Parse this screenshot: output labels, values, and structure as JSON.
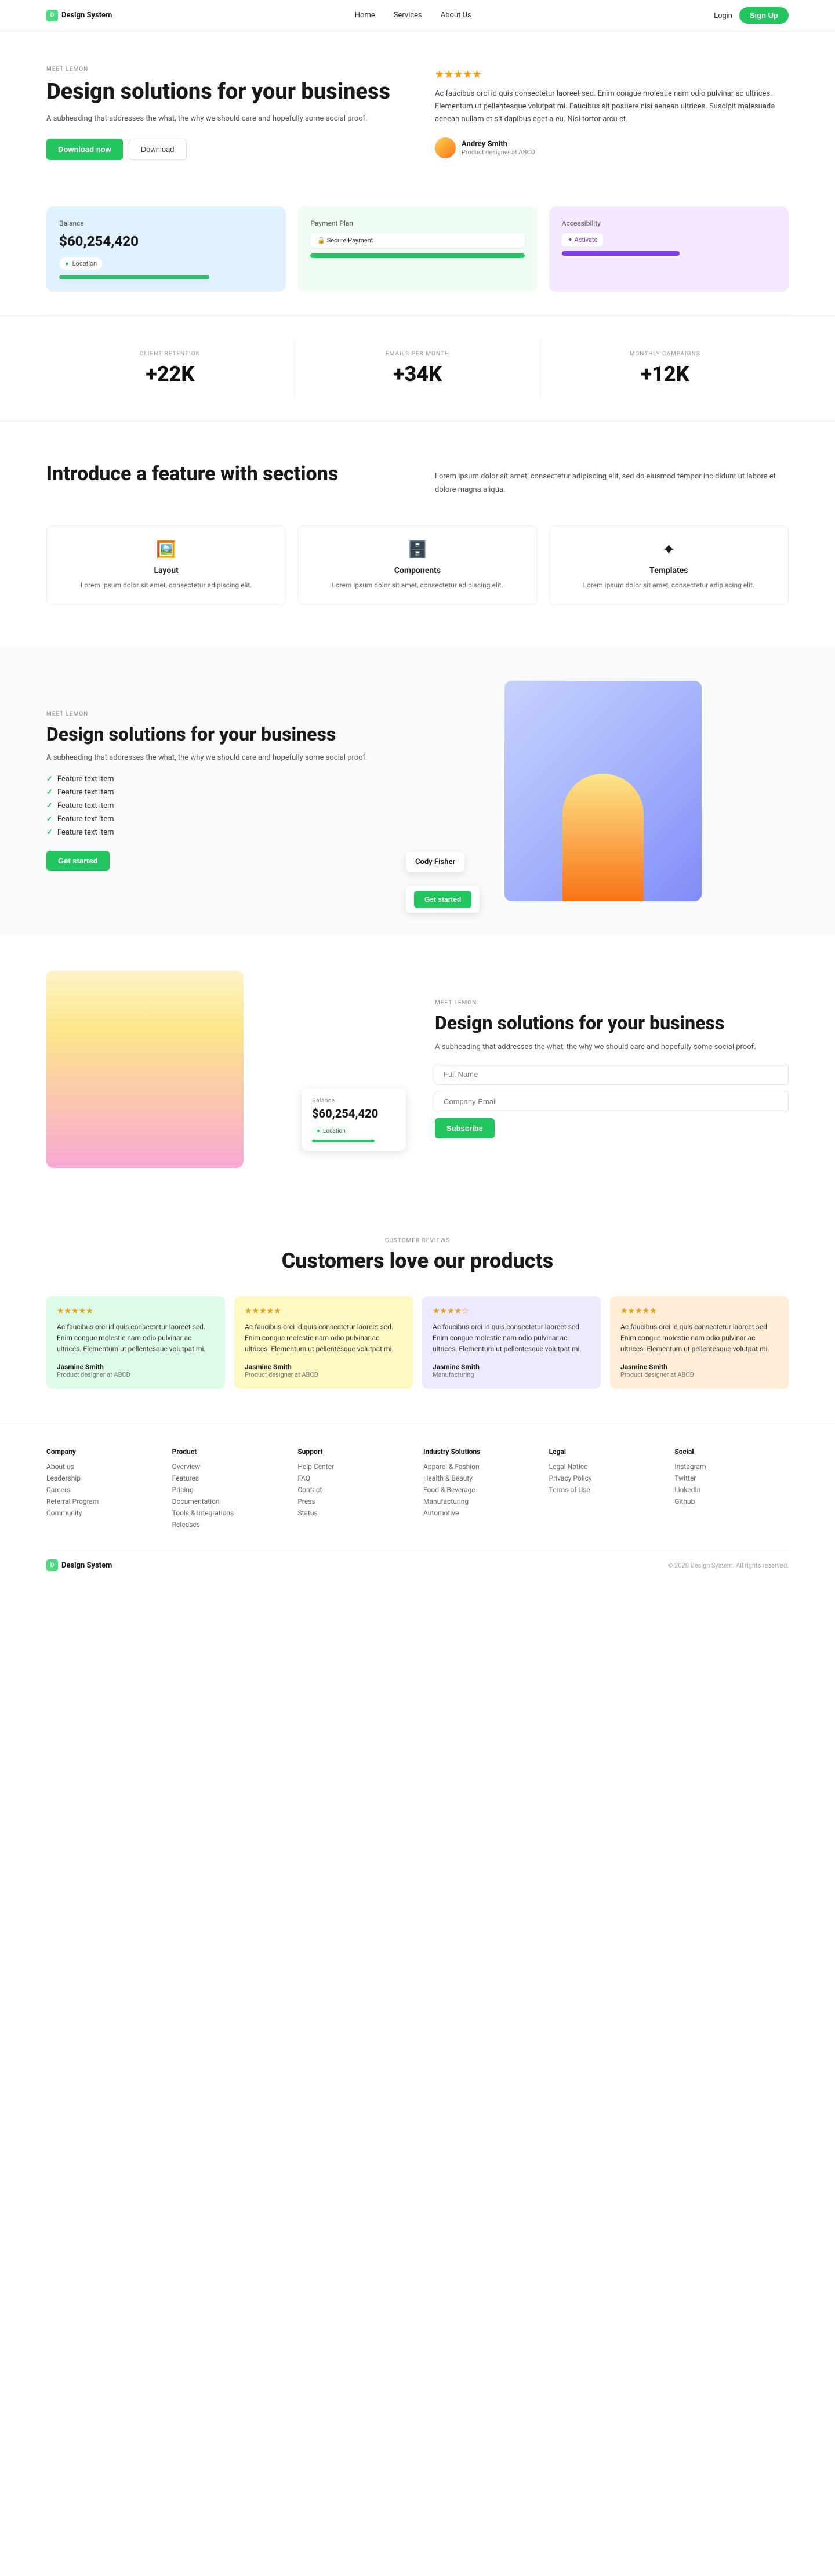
{
  "nav": {
    "logo": "Design System",
    "links": [
      "Home",
      "Services",
      "About Us"
    ],
    "login": "Login",
    "signup": "Sign Up"
  },
  "hero": {
    "meet": "MEET LEMON",
    "title": "Design solutions for your business",
    "subtitle": "A subheading that addresses the what, the why we should care and hopefully some social proof.",
    "btn_primary": "Download now",
    "btn_secondary": "Download",
    "stars": "★★★★★",
    "review_text": "Ac faucibus orci id quis consectetur laoreet sed. Enim congue molestie nam odio pulvinar ac ultrices. Elementum ut pellentesque volutpat mi. Faucibus sit posuere nisi aenean ultrices. Suscipit malesuada aenean nullam et sit dapibus eget a eu. Nisl tortor arcu et.",
    "reviewer_name": "Andrey Smith",
    "reviewer_role": "Product designer at ABCD"
  },
  "cards": {
    "balance": {
      "label": "Balance",
      "amount": "$60,254,420",
      "location": "Location"
    },
    "payment": {
      "label": "Payment Plan",
      "secure": "🔒 Secure Payment"
    },
    "accessibility": {
      "label": "Accessibility",
      "activate": "✦ Activate"
    }
  },
  "stats": [
    {
      "label": "CLIENT RETENTION",
      "value": "+22K"
    },
    {
      "label": "EMAILS PER MONTH",
      "value": "+34K"
    },
    {
      "label": "MONTHLY CAMPAIGNS",
      "value": "+12K"
    }
  ],
  "feature_section": {
    "title": "Introduce a feature with sections",
    "description": "Lorem ipsum dolor sit amet, consectetur adipiscing elit, sed do eiusmod tempor incididunt ut labore et dolore magna aliqua.",
    "cards": [
      {
        "icon": "🖼️",
        "title": "Layout",
        "desc": "Lorem ipsum dolor sit amet, consectetur adipiscing elit."
      },
      {
        "icon": "🗄️",
        "title": "Components",
        "desc": "Lorem ipsum dolor sit amet, consectetur adipiscing elit."
      },
      {
        "icon": "✦",
        "title": "Templates",
        "desc": "Lorem ipsum dolor sit amet, consectetur adipiscing elit."
      }
    ]
  },
  "split1": {
    "meet": "MEET LEMON",
    "title": "Design solutions for your business",
    "subtitle": "A subheading that addresses the what, the why we should care and hopefully some social proof.",
    "features": [
      "Feature text item",
      "Feature text item",
      "Feature text item",
      "Feature text item",
      "Feature text item"
    ],
    "cta": "Get started",
    "person_name": "Cody Fisher",
    "get_started": "Get started"
  },
  "split2": {
    "meet": "MEET LEMON",
    "title": "Design solutions for your business",
    "subtitle": "A subheading that addresses the what, the why we should care and hopefully some social proof.",
    "balance_label": "Balance",
    "balance_amount": "$60,254,420",
    "location": "Location",
    "form": {
      "name_placeholder": "Full Name",
      "email_placeholder": "Company Email",
      "submit": "Subscribe"
    }
  },
  "reviews": {
    "eyebrow": "CUSTOMER REVIEWS",
    "title": "Customers love our products",
    "items": [
      {
        "stars": "★★★★★",
        "text": "Ac faucibus orci id quis consectetur laoreet sed. Enim congue molestie nam odio pulvinar ac ultrices. Elementum ut pellentesque volutpat mi.",
        "name": "Jasmine Smith",
        "role": "Product designer at ABCD",
        "color": "green"
      },
      {
        "stars": "★★★★★",
        "text": "Ac faucibus orci id quis consectetur laoreet sed. Enim congue molestie nam odio pulvinar ac ultrices. Elementum ut pellentesque volutpat mi.",
        "name": "Jasmine Smith",
        "role": "Product designer at ABCD",
        "color": "yellow"
      },
      {
        "stars": "★★★★☆",
        "text": "Ac faucibus orci id quis consectetur laoreet sed. Enim congue molestie nam odio pulvinar ac ultrices. Elementum ut pellentesque volutpat mi.",
        "name": "Jasmine Smith",
        "role": "Manufacturing",
        "color": "purple"
      },
      {
        "stars": "★★★★★",
        "text": "Ac faucibus orci id quis consectetur laoreet sed. Enim congue molestie nam odio pulvinar ac ultrices. Elementum ut pellentesque volutpat mi.",
        "name": "Jasmine Smith",
        "role": "Product designer at ABCD",
        "color": "orange"
      }
    ]
  },
  "footer": {
    "logo": "Design System",
    "columns": [
      {
        "heading": "Company",
        "links": [
          "About us",
          "Leadership",
          "Careers",
          "Referral Program",
          "Community"
        ]
      },
      {
        "heading": "Product",
        "links": [
          "Overview",
          "Features",
          "Pricing",
          "Documentation",
          "Tools & Integrations",
          "Releases"
        ]
      },
      {
        "heading": "Support",
        "links": [
          "Help Center",
          "FAQ",
          "Contact",
          "Press",
          "Status"
        ]
      },
      {
        "heading": "Industry Solutions",
        "links": [
          "Apparel & Fashion",
          "Health & Beauty",
          "Food & Beverage",
          "Manufacturing",
          "Automotive"
        ]
      },
      {
        "heading": "Legal",
        "links": [
          "Legal Notice",
          "Privacy Policy",
          "Terms of Use"
        ]
      },
      {
        "heading": "Social",
        "links": [
          "Instagram",
          "Twitter",
          "LinkedIn",
          "Github"
        ]
      }
    ],
    "copyright": "© 2020 Design System. All rights reserved."
  }
}
